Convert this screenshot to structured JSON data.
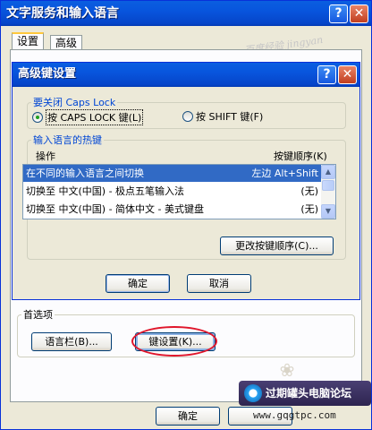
{
  "outer_window": {
    "title": "文字服务和输入语言",
    "help_button": "?",
    "close_button": "✕"
  },
  "tabs": [
    {
      "label": "设置",
      "active": true
    },
    {
      "label": "高级",
      "active": false
    }
  ],
  "watermark": "百度经验 jingyan",
  "advanced_dialog": {
    "title": "高级键设置",
    "help_button": "?",
    "close_button": "✕",
    "caps_group": {
      "legend": "要关闭 Caps Lock",
      "option_caps": "按 CAPS LOCK 键(L)",
      "option_shift": "按 SHIFT 键(F)",
      "selected": "caps"
    },
    "hotkey_group": {
      "legend": "输入语言的热键",
      "col_action": "操作",
      "col_sequence": "按键顺序(K)",
      "rows": [
        {
          "action": "在不同的输入语言之间切换",
          "keys": "左边 Alt+Shift",
          "selected": true
        },
        {
          "action": "切换至 中文(中国) - 极点五笔输入法",
          "keys": "(无)",
          "selected": false
        },
        {
          "action": "切换至 中文(中国) - 简体中文 - 美式键盘",
          "keys": "(无)",
          "selected": false
        }
      ],
      "change_button": "更改按键顺序(C)..."
    },
    "ok_button": "确定",
    "cancel_button": "取消"
  },
  "preferences": {
    "legend": "首选项",
    "language_bar_button": "语言栏(B)...",
    "key_settings_button": "键设置(K)..."
  },
  "footer": {
    "ok_button": "确定"
  },
  "logo": {
    "name": "过期罐头电脑论坛",
    "url": "www.gqgtpc.com"
  },
  "colors": {
    "titlebar": "#0855dd",
    "group_legend": "#0046d5",
    "selection": "#316ac5",
    "highlight_oval": "#e0162b"
  }
}
